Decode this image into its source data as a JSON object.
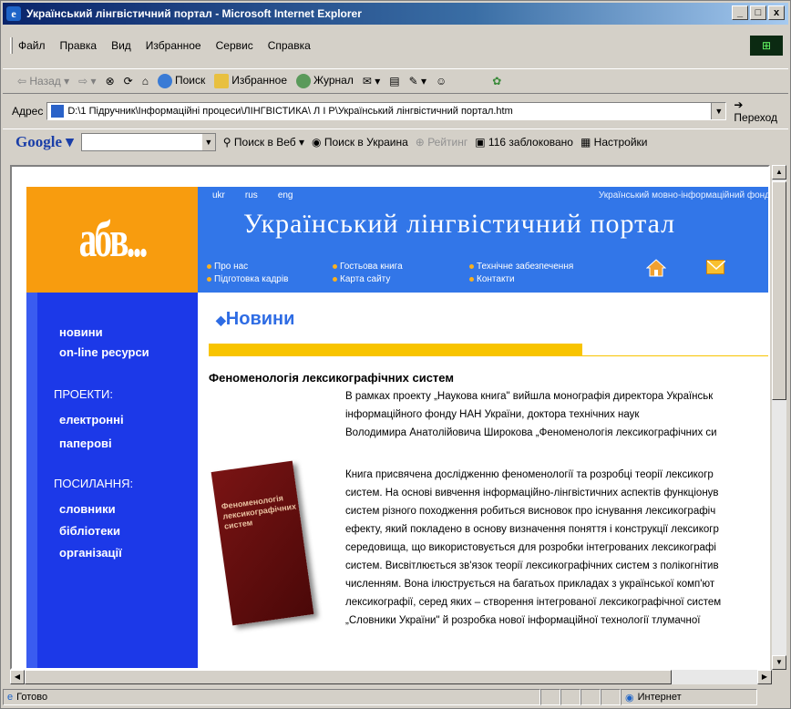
{
  "window": {
    "title": "Український лінгвістичний портал - Microsoft Internet Explorer",
    "minimize": "_",
    "restore": "□",
    "close": "x"
  },
  "menu": [
    "Файл",
    "Правка",
    "Вид",
    "Избранное",
    "Сервис",
    "Справка"
  ],
  "toolbar": {
    "back": "Назад",
    "search": "Поиск",
    "favorites": "Избранное",
    "history": "Журнал"
  },
  "address": {
    "label": "Адрес",
    "value": "D:\\1 Підручник\\Інформаційні процеси\\ЛІНГВІСТИКА\\ Л І Р\\Український лінгвістичний портал.htm",
    "go": "Переход"
  },
  "googlebar": {
    "logo": "Google",
    "search_web": "Поиск в Веб",
    "search_ukraine": "Поиск в Украина",
    "pagerank": "Рейтинг",
    "blocked": "116 заблоковано",
    "settings": "Настройки"
  },
  "site": {
    "logo": "абв...",
    "langs": [
      "ukr",
      "rus",
      "eng"
    ],
    "top_right": "Український мовно-інформаційний фонд",
    "title": "Український лінгвістичний портал",
    "nav": {
      "about": "Про нас",
      "training": "Підготовка кадрів",
      "guestbook": "Гостьова книга",
      "sitemap": "Карта сайту",
      "support": "Технічне забезпечення",
      "contacts": "Контакти"
    },
    "sidebar": {
      "news": "новини",
      "online": "on-line ресурси",
      "projects_head": "ПРОЕКТИ:",
      "electronic": "електронні",
      "paper": "паперові",
      "links_head": "ПОСИЛАННЯ:",
      "dictionaries": "словники",
      "libraries": "бібліотеки",
      "organizations": "організації"
    },
    "news_heading": "Новини",
    "article_title": "Феноменологія лексикографічних систем",
    "book_cover": "Феноменологія лексикографічних систем",
    "intro_lines": [
      "В рамках проекту „Наукова книга\" вийшла монографія директора Українськ",
      "інформаційного фонду НАН України, доктора технічних наук",
      "Володимира Анатолійовича Широкова „Феноменологія лексикографічних си"
    ],
    "body_lines": [
      "Книга присвячена дослідженню феноменології та розробці теорії лексикогр",
      "систем. На основі вивчення інформаційно-лінгвістичних аспектів функціонув",
      "систем різного походження робиться висновок про існування лексикографіч",
      "ефекту, який покладено в основу визначення поняття і конструкції лексикогр",
      "середовища, що використовується для розробки інтегрованих лексикографі",
      "систем. Висвітлюється зв'язок теорії лексикографічних систем з полікогнітив",
      "численням. Вона ілюструється на багатьох прикладах з української комп'ют",
      "лексикографії, серед яких – створення інтегрованої лексикографічної систем",
      "„Словники України\" й розробка нової інформаційної технології тлумачної"
    ]
  },
  "status": {
    "left": "Готово",
    "zone": "Интернет"
  }
}
